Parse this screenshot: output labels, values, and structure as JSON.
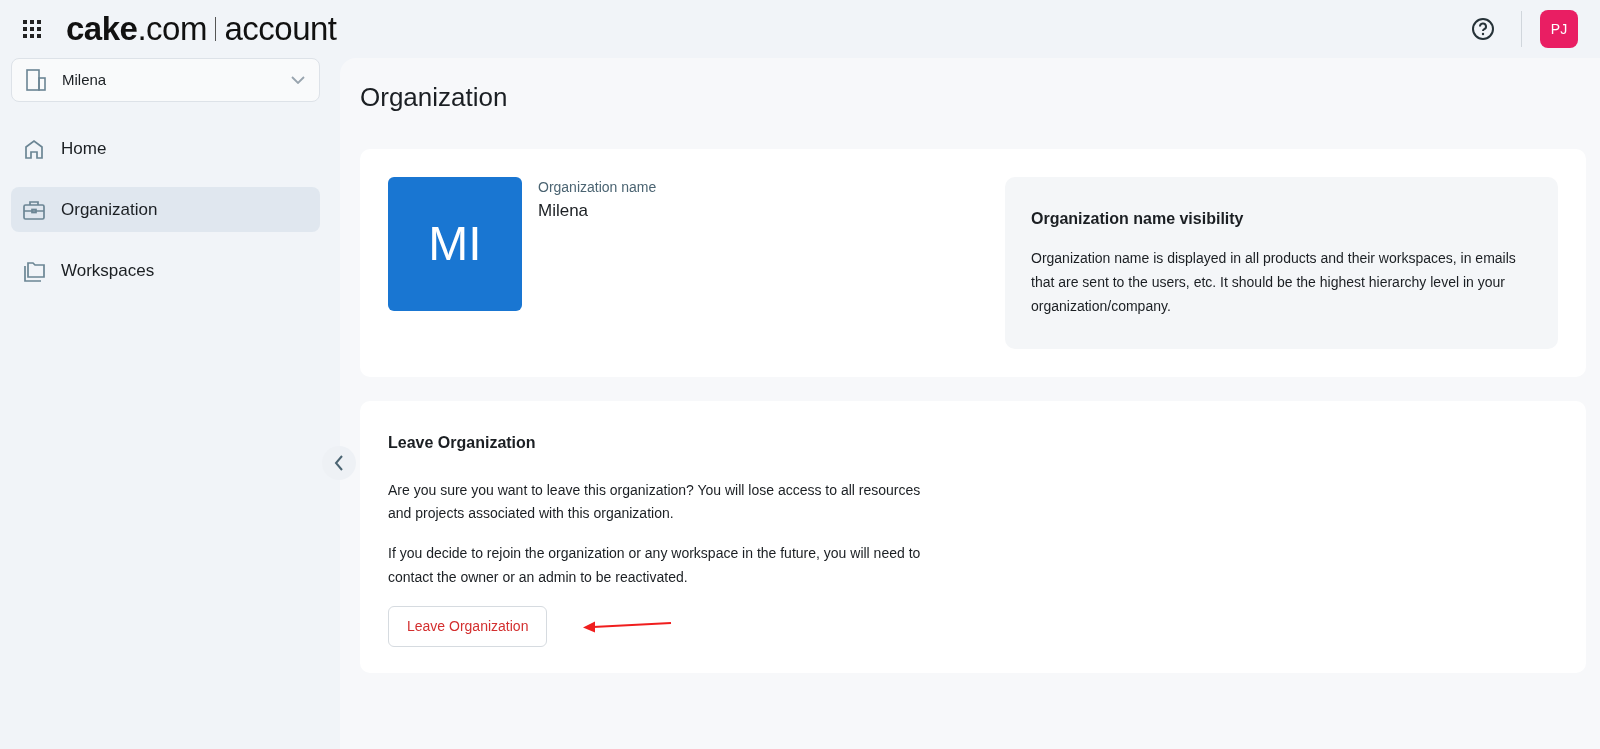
{
  "header": {
    "brand": "**cake**.com",
    "product": "account",
    "avatar": "PJ"
  },
  "sidebar": {
    "org_selector": {
      "label": "Milena"
    },
    "items": [
      {
        "label": "Home",
        "selected": false
      },
      {
        "label": "Organization",
        "selected": true
      },
      {
        "label": "Workspaces",
        "selected": false
      }
    ]
  },
  "page": {
    "title": "Organization",
    "org_card": {
      "initials": "MI",
      "field_label": "Organization name",
      "field_value": "Milena",
      "info": {
        "title": "Organization name visibility",
        "text": "Organization name is displayed in all products and their workspaces, in emails that are sent to the users, etc. It should be the highest hierarchy level in your organization/company."
      }
    },
    "leave_card": {
      "title": "Leave Organization",
      "paragraphs": [
        "Are you sure you want to leave this organization? You will lose access to all resources and projects associated with this organization.",
        "If you decide to rejoin the organization or any workspace in the future, you will need to contact the owner or an admin to be reactivated."
      ],
      "button": "Leave Organization"
    }
  }
}
